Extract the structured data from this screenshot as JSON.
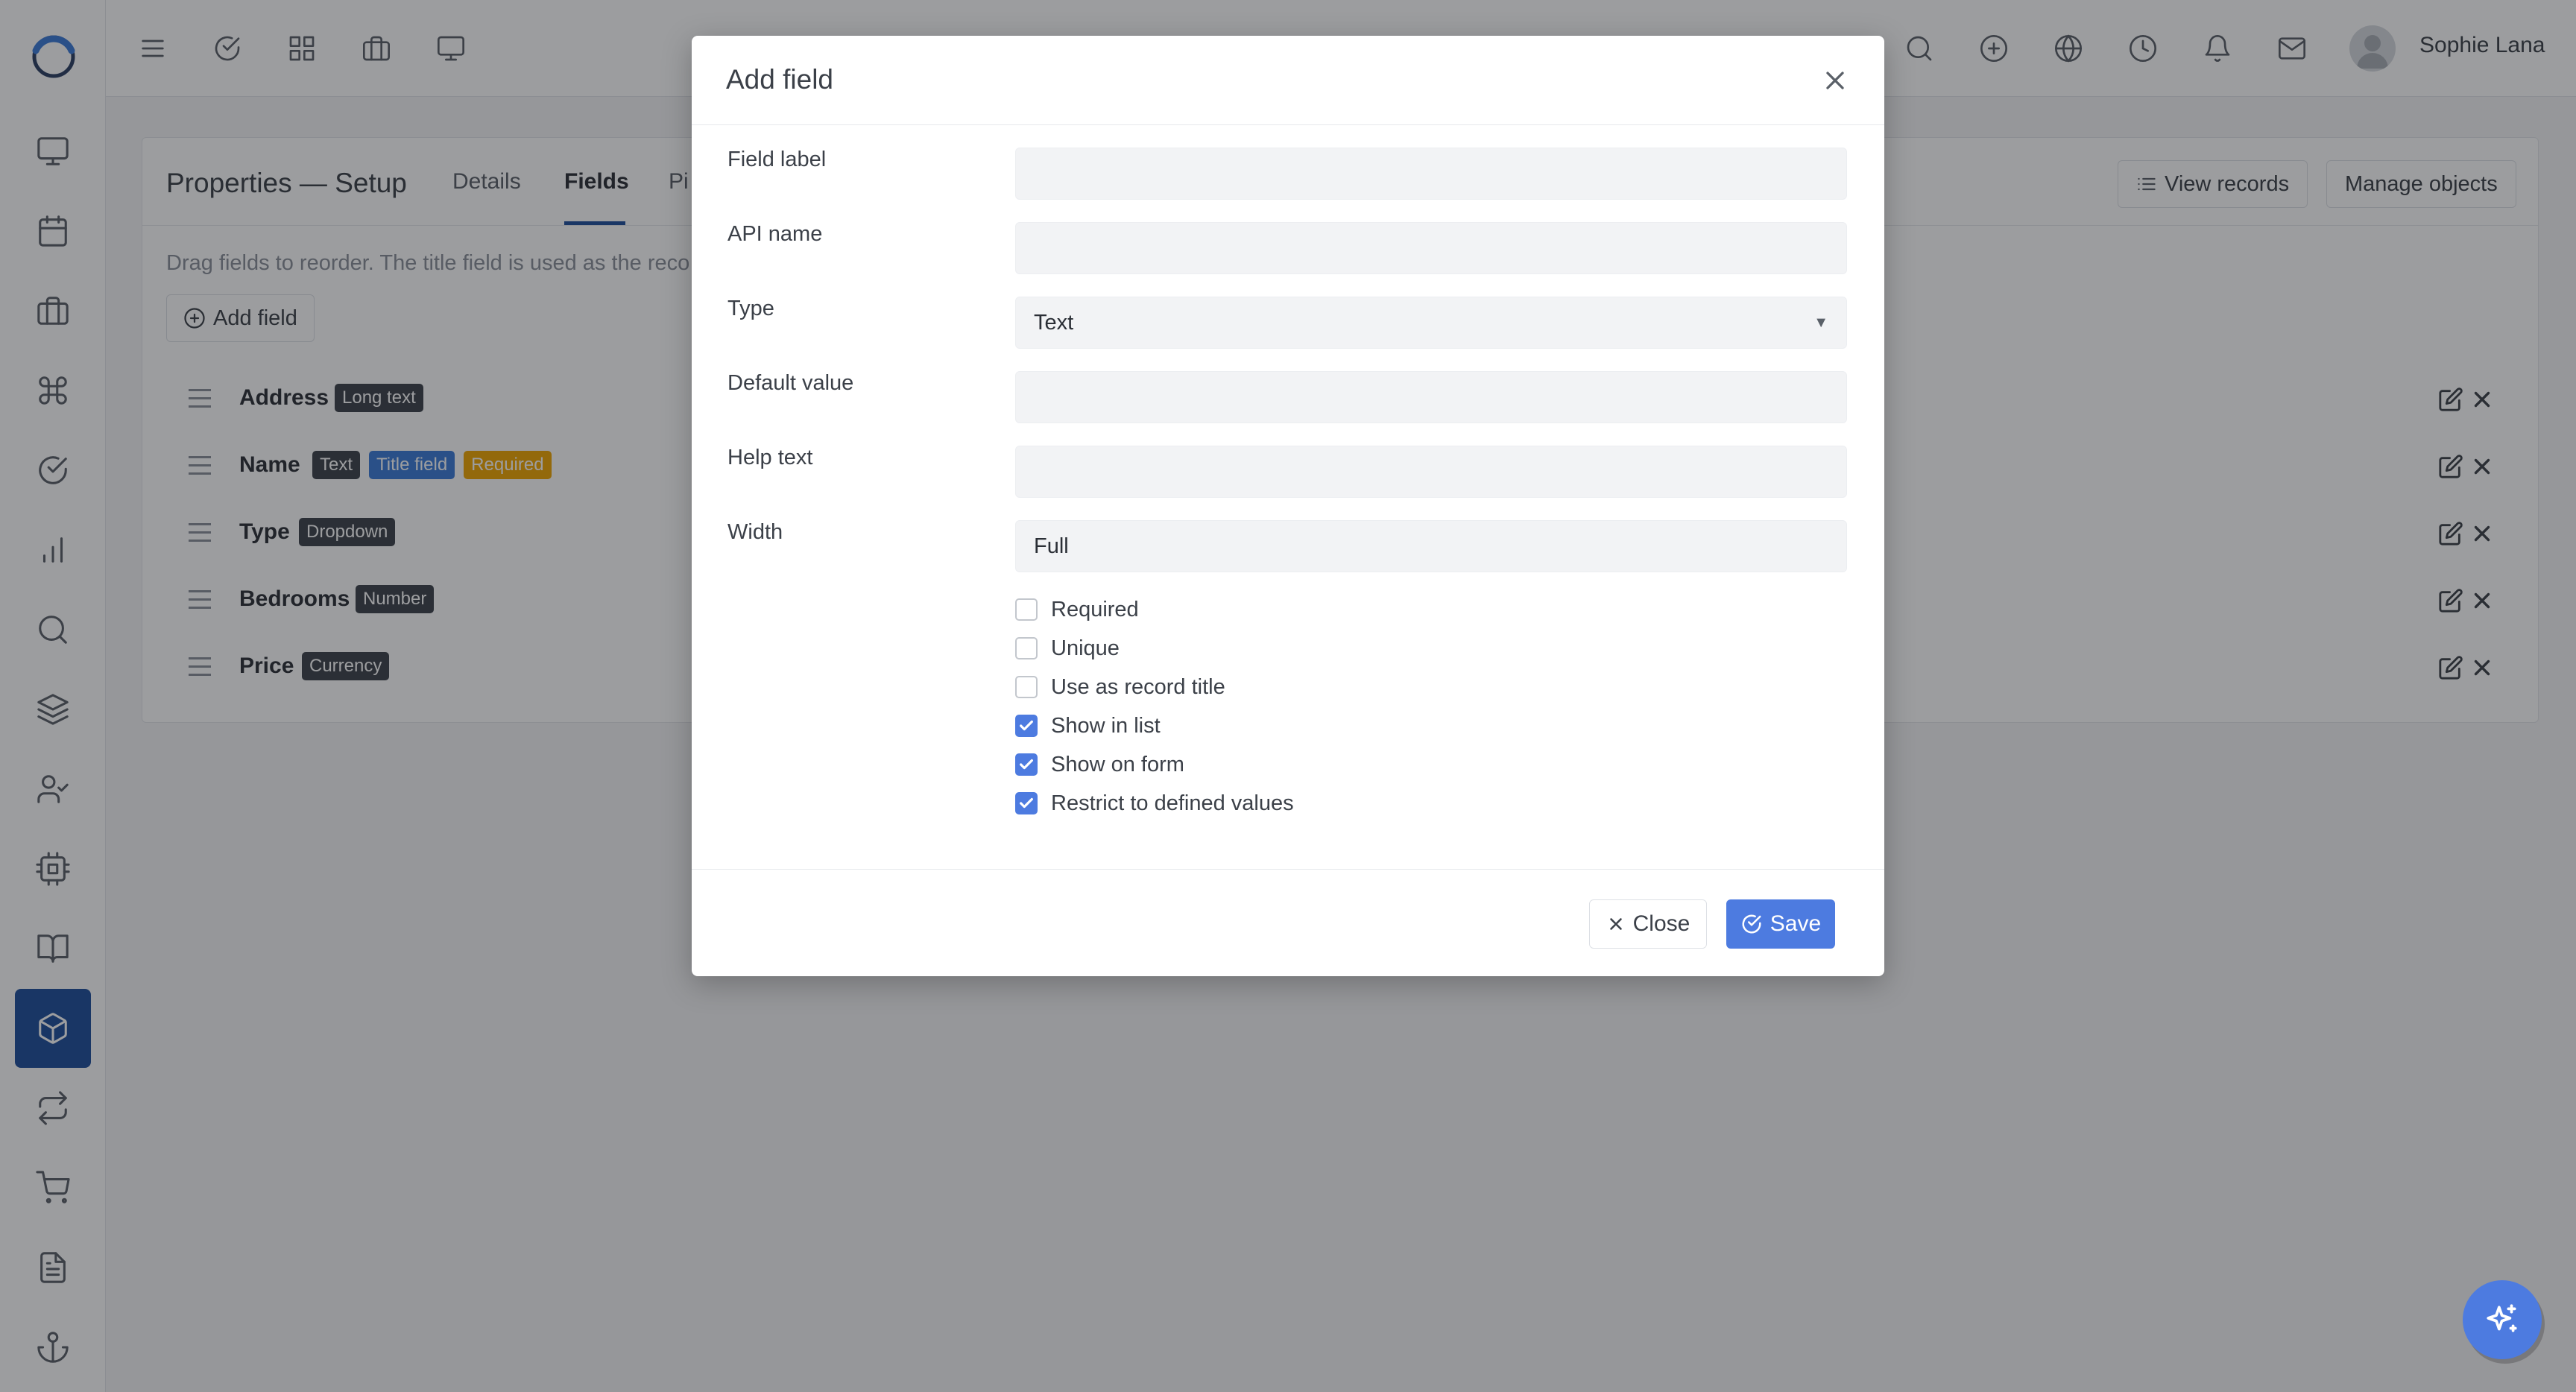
{
  "user": {
    "name": "Sophie Lana"
  },
  "page": {
    "title": "Properties — Setup",
    "tabs": [
      "Details",
      "Fields",
      "Pipelines"
    ],
    "tab_visible": [
      "Details",
      "Fields",
      "Pi"
    ],
    "active_tab": "Fields",
    "view_records": "View records",
    "manage_objects": "Manage objects",
    "hint": "Drag fields to reorder. The title field is used as the reco",
    "add_field": "Add field"
  },
  "fields": [
    {
      "name": "Address",
      "badges": [
        {
          "text": "Long text",
          "kind": "dark"
        }
      ]
    },
    {
      "name": "Name",
      "badges": [
        {
          "text": "Text",
          "kind": "dark"
        },
        {
          "text": "Title field",
          "kind": "blue"
        },
        {
          "text": "Required",
          "kind": "amber"
        }
      ]
    },
    {
      "name": "Type",
      "badges": [
        {
          "text": "Dropdown",
          "kind": "dark"
        }
      ]
    },
    {
      "name": "Bedrooms",
      "badges": [
        {
          "text": "Number",
          "kind": "dark"
        }
      ]
    },
    {
      "name": "Price",
      "badges": [
        {
          "text": "Currency",
          "kind": "dark"
        }
      ]
    }
  ],
  "modal": {
    "title": "Add field",
    "labels": {
      "field_label": "Field label",
      "api_name": "API name",
      "type": "Type",
      "default_value": "Default value",
      "help_text": "Help text",
      "width": "Width"
    },
    "values": {
      "field_label": "",
      "api_name": "",
      "type": "Text",
      "default_value": "",
      "help_text": "",
      "width": "Full"
    },
    "options": [
      {
        "label": "Required",
        "checked": false
      },
      {
        "label": "Unique",
        "checked": false
      },
      {
        "label": "Use as record title",
        "checked": false
      },
      {
        "label": "Show in list",
        "checked": true
      },
      {
        "label": "Show on form",
        "checked": true
      },
      {
        "label": "Restrict to defined values",
        "checked": true
      }
    ],
    "close_label": "Close",
    "save_label": "Save"
  },
  "colors": {
    "accent": "#4d7be0",
    "sidebar_active": "#1e4e9c",
    "badge_dark": "#3d434b",
    "badge_blue": "#3b7bd8",
    "badge_amber": "#f0a500"
  },
  "icons": {
    "sidebar": [
      "monitor-icon",
      "calendar-icon",
      "briefcase-icon",
      "command-icon",
      "check-circle-icon",
      "bar-chart-icon",
      "search-icon",
      "layers-icon",
      "user-check-icon",
      "cpu-icon",
      "book-icon",
      "box-icon",
      "repeat-icon",
      "cart-icon",
      "file-text-icon",
      "anchor-icon"
    ],
    "topbar_left": [
      "menu-icon",
      "check-circle-icon",
      "grid-icon",
      "briefcase-icon",
      "monitor-icon"
    ],
    "topbar_right": [
      "search-icon",
      "plus-circle-icon",
      "globe-icon",
      "clock-icon",
      "bell-icon",
      "mail-icon"
    ]
  }
}
